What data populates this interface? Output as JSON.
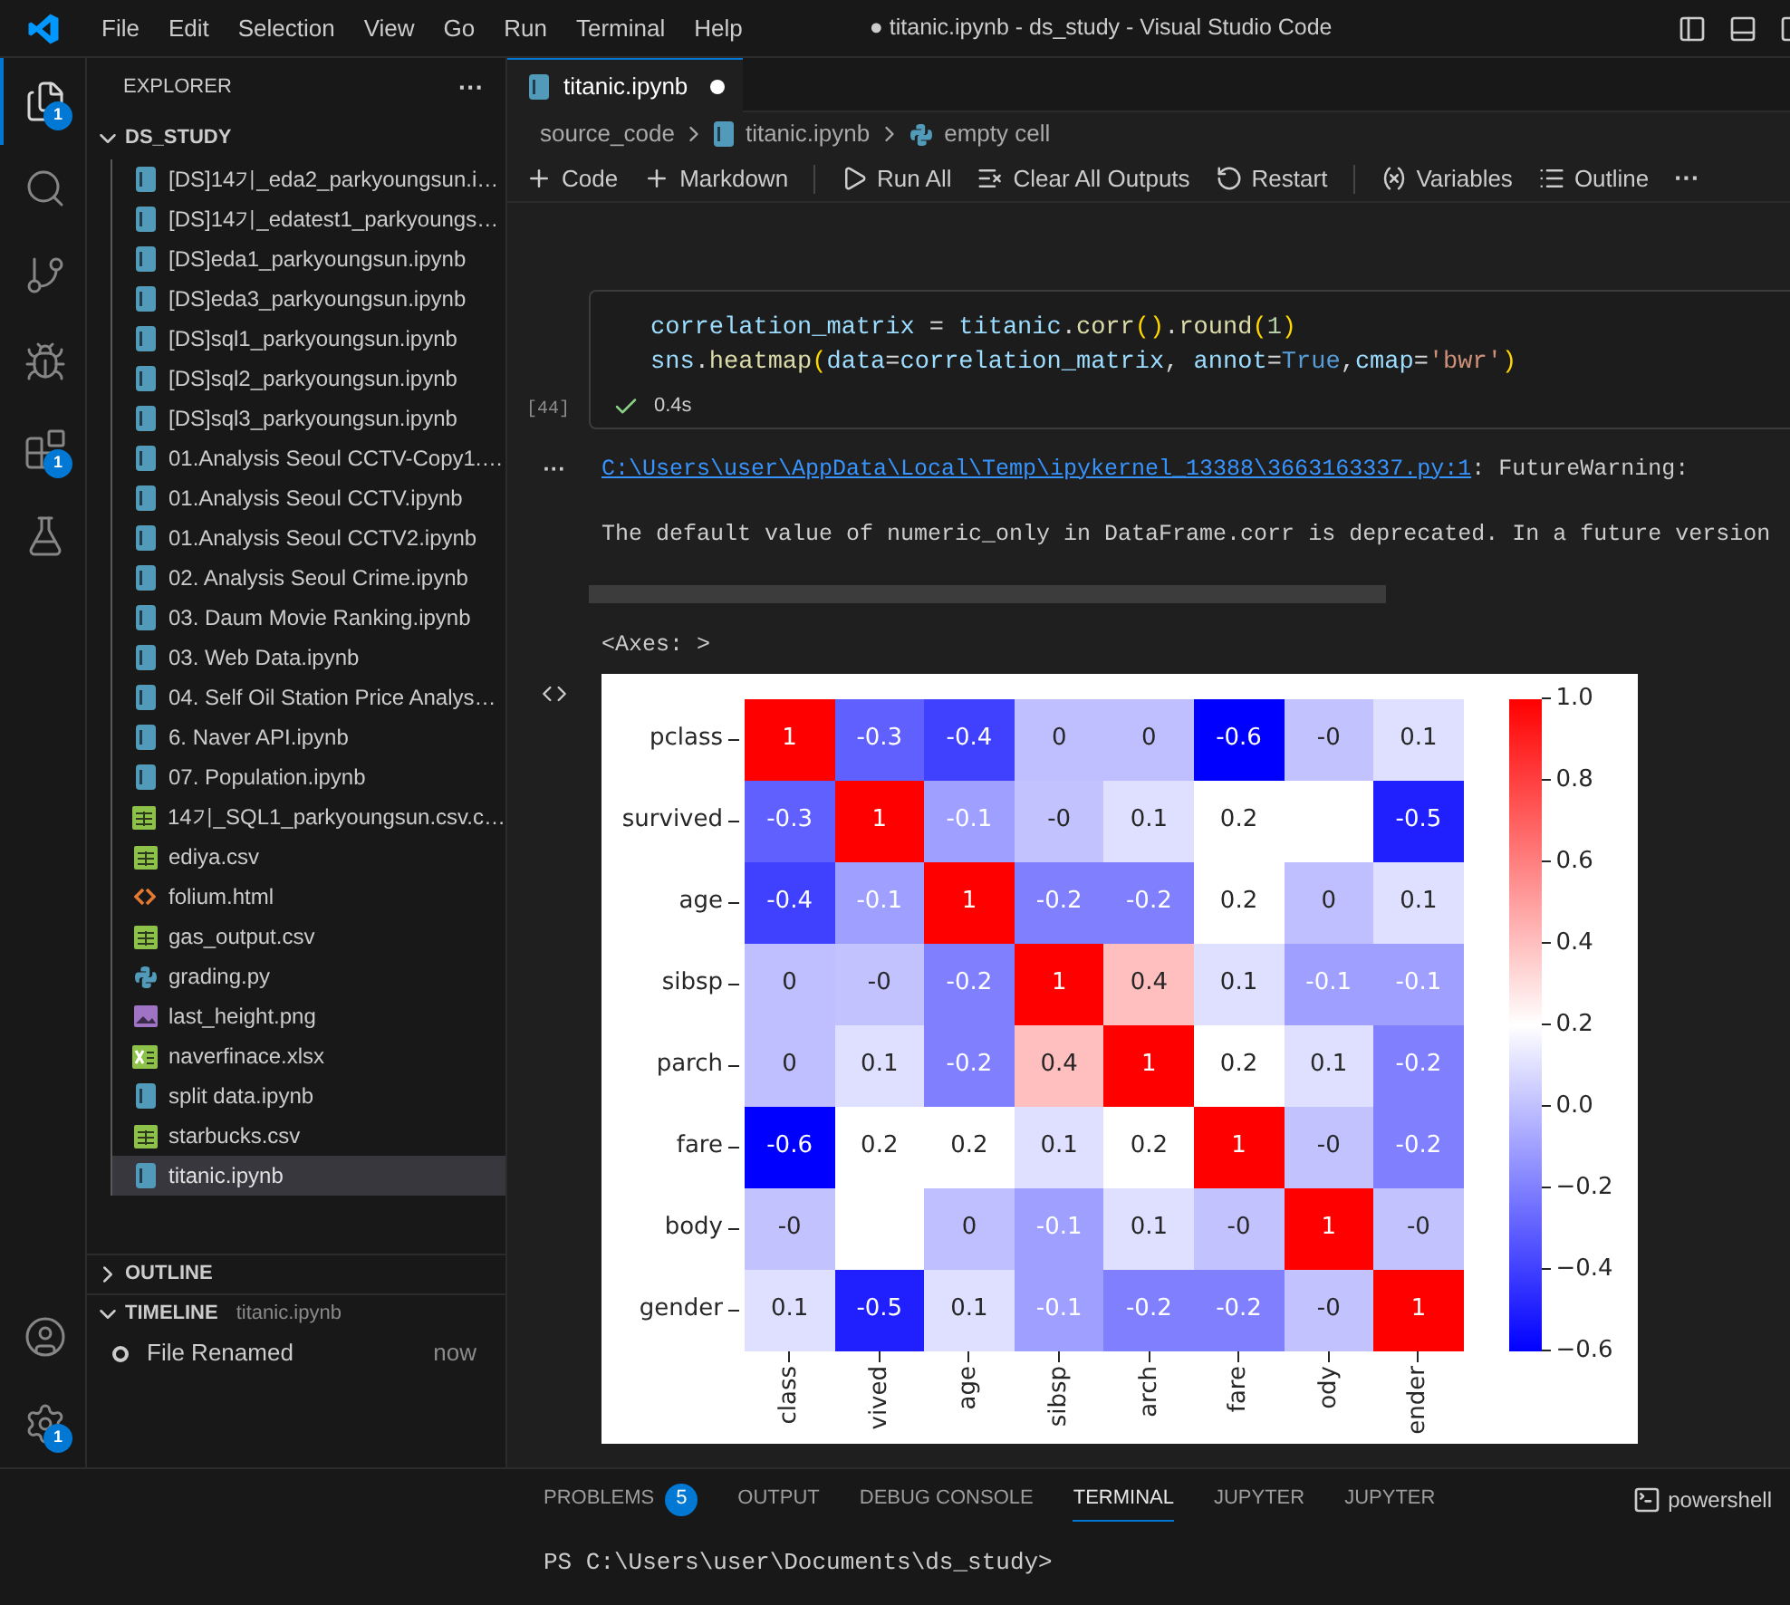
{
  "title_bar": {
    "menus": [
      "File",
      "Edit",
      "Selection",
      "View",
      "Go",
      "Run",
      "Terminal",
      "Help"
    ],
    "title": "● titanic.ipynb - ds_study - Visual Studio Code"
  },
  "activity_bar": {
    "items": [
      {
        "kind": "explorer",
        "selected": true,
        "badge": "1"
      },
      {
        "kind": "search",
        "selected": false
      },
      {
        "kind": "source_control",
        "selected": false
      },
      {
        "kind": "run_debug",
        "selected": false
      },
      {
        "kind": "extensions",
        "selected": false,
        "badge": "1"
      },
      {
        "kind": "testing",
        "selected": false
      }
    ],
    "bottom": [
      {
        "kind": "account",
        "selected": false
      },
      {
        "kind": "settings",
        "selected": false,
        "badge": "1"
      }
    ]
  },
  "sidebar": {
    "title": "EXPLORER",
    "more": "···",
    "folder": "DS_STUDY",
    "files": [
      {
        "name": "[DS]14기_eda2_parkyoungsun.i…",
        "kind": "notebook",
        "selected": false
      },
      {
        "name": "[DS]14기_edatest1_parkyoungs…",
        "kind": "notebook",
        "selected": false
      },
      {
        "name": "[DS]eda1_parkyoungsun.ipynb",
        "kind": "notebook",
        "selected": false
      },
      {
        "name": "[DS]eda3_parkyoungsun.ipynb",
        "kind": "notebook",
        "selected": false
      },
      {
        "name": "[DS]sql1_parkyoungsun.ipynb",
        "kind": "notebook",
        "selected": false
      },
      {
        "name": "[DS]sql2_parkyoungsun.ipynb",
        "kind": "notebook",
        "selected": false
      },
      {
        "name": "[DS]sql3_parkyoungsun.ipynb",
        "kind": "notebook",
        "selected": false
      },
      {
        "name": "01.Analysis Seoul CCTV-Copy1.…",
        "kind": "notebook",
        "selected": false
      },
      {
        "name": "01.Analysis Seoul CCTV.ipynb",
        "kind": "notebook",
        "selected": false
      },
      {
        "name": "01.Analysis Seoul CCTV2.ipynb",
        "kind": "notebook",
        "selected": false
      },
      {
        "name": "02. Analysis Seoul Crime.ipynb",
        "kind": "notebook",
        "selected": false
      },
      {
        "name": "03. Daum Movie Ranking.ipynb",
        "kind": "notebook",
        "selected": false
      },
      {
        "name": "03. Web Data.ipynb",
        "kind": "notebook",
        "selected": false
      },
      {
        "name": "04. Self Oil Station Price Analys…",
        "kind": "notebook",
        "selected": false
      },
      {
        "name": "6. Naver API.ipynb",
        "kind": "notebook",
        "selected": false
      },
      {
        "name": "07. Population.ipynb",
        "kind": "notebook",
        "selected": false
      },
      {
        "name": "14기_SQL1_parkyoungsun.csv.c…",
        "kind": "csv",
        "selected": false
      },
      {
        "name": "ediya.csv",
        "kind": "csv",
        "selected": false
      },
      {
        "name": "folium.html",
        "kind": "html",
        "selected": false
      },
      {
        "name": "gas_output.csv",
        "kind": "csv",
        "selected": false
      },
      {
        "name": "grading.py",
        "kind": "python",
        "selected": false
      },
      {
        "name": "last_height.png",
        "kind": "image",
        "selected": false
      },
      {
        "name": "naverfinace.xlsx",
        "kind": "excel",
        "selected": false
      },
      {
        "name": "split data.ipynb",
        "kind": "notebook",
        "selected": false
      },
      {
        "name": "starbucks.csv",
        "kind": "csv",
        "selected": false
      },
      {
        "name": "titanic.ipynb",
        "kind": "notebook",
        "selected": true
      }
    ],
    "outline": {
      "title": "OUTLINE",
      "expanded": false
    },
    "timeline": {
      "title": "TIMELINE",
      "expanded": true,
      "file": "titanic.ipynb",
      "events": [
        {
          "label": "File Renamed",
          "time": "now"
        }
      ]
    }
  },
  "editor": {
    "tabs": [
      {
        "label": "titanic.ipynb",
        "selected": true,
        "modified": true
      }
    ],
    "breadcrumbs": [
      {
        "label": "source_code",
        "kind": "folder"
      },
      {
        "label": "titanic.ipynb",
        "kind": "notebook"
      },
      {
        "label": "empty cell",
        "kind": "python"
      }
    ],
    "toolbar": [
      {
        "label": "Code",
        "kind": "add"
      },
      {
        "label": "Markdown",
        "kind": "add"
      },
      {
        "label": "Run All",
        "kind": "run"
      },
      {
        "label": "Clear All Outputs",
        "kind": "clear"
      },
      {
        "label": "Restart",
        "kind": "restart"
      },
      {
        "label": "Variables",
        "kind": "variables"
      },
      {
        "label": "Outline",
        "kind": "outline"
      }
    ],
    "toolbar_more": "···"
  },
  "cell": {
    "execution_count": "[44]",
    "success": true,
    "duration": "0.4s",
    "lines": [
      [
        {
          "text": "correlation_matrix",
          "kind": "var"
        },
        {
          "text": " = ",
          "kind": "op"
        },
        {
          "text": "titanic",
          "kind": "var"
        },
        {
          "text": ".",
          "kind": "op"
        },
        {
          "text": "corr",
          "kind": "fn"
        },
        {
          "text": "()",
          "kind": "paren"
        },
        {
          "text": ".",
          "kind": "op"
        },
        {
          "text": "round",
          "kind": "fn"
        },
        {
          "text": "(",
          "kind": "paren"
        },
        {
          "text": "1",
          "kind": "num"
        },
        {
          "text": ")",
          "kind": "paren"
        }
      ],
      [
        {
          "text": "sns",
          "kind": "var"
        },
        {
          "text": ".",
          "kind": "op"
        },
        {
          "text": "heatmap",
          "kind": "fn"
        },
        {
          "text": "(",
          "kind": "paren"
        },
        {
          "text": "data",
          "kind": "var"
        },
        {
          "text": "=",
          "kind": "op"
        },
        {
          "text": "correlation_matrix",
          "kind": "var"
        },
        {
          "text": ", ",
          "kind": "op"
        },
        {
          "text": "annot",
          "kind": "var"
        },
        {
          "text": "=",
          "kind": "op"
        },
        {
          "text": "True",
          "kind": "kw"
        },
        {
          "text": ",",
          "kind": "op"
        },
        {
          "text": "cmap",
          "kind": "var"
        },
        {
          "text": "=",
          "kind": "op"
        },
        {
          "text": "'bwr'",
          "kind": "str"
        },
        {
          "text": ")",
          "kind": "paren"
        }
      ]
    ]
  },
  "output": {
    "more": "···",
    "warning_link": "C:\\Users\\user\\AppData\\Local\\Temp\\ipykernel_13388\\3663163337.py:1",
    "warning_label": ": FutureWarning:",
    "warning_text": "The default value of numeric_only in DataFrame.corr is deprecated. In a future version",
    "result": "<Axes: >",
    "figure": {
      "row_labels": [
        "pclass",
        "survived",
        "age",
        "sibsp",
        "parch",
        "fare",
        "body",
        "gender"
      ],
      "column_labels": [
        "class",
        "vived",
        "age",
        "sibsp",
        "arch",
        "fare",
        "ody",
        "ender"
      ],
      "cells": [
        [
          {
            "text": "1",
            "color": "#ff0000"
          },
          {
            "text": "-0.3",
            "color": "#6060ff"
          },
          {
            "text": "-0.4",
            "color": "#4040ff"
          },
          {
            "text": "0",
            "color": "#bfbfff"
          },
          {
            "text": "0",
            "color": "#bfbfff"
          },
          {
            "text": "-0.6",
            "color": "#0000ff"
          },
          {
            "text": "-0",
            "color": "#c2c2ff"
          },
          {
            "text": "0.1",
            "color": "#dfdfff"
          }
        ],
        [
          {
            "text": "-0.3",
            "color": "#6060ff"
          },
          {
            "text": "1",
            "color": "#ff0000"
          },
          {
            "text": "-0.1",
            "color": "#9f9fff"
          },
          {
            "text": "-0",
            "color": "#c2c2ff"
          },
          {
            "text": "0.1",
            "color": "#dfdfff"
          },
          {
            "text": "0.2",
            "color": "#ffffff"
          },
          null,
          {
            "text": "-0.5",
            "color": "#2020ff"
          }
        ],
        [
          {
            "text": "-0.4",
            "color": "#4040ff"
          },
          {
            "text": "-0.1",
            "color": "#9f9fff"
          },
          {
            "text": "1",
            "color": "#ff0000"
          },
          {
            "text": "-0.2",
            "color": "#8080ff"
          },
          {
            "text": "-0.2",
            "color": "#8080ff"
          },
          {
            "text": "0.2",
            "color": "#ffffff"
          },
          {
            "text": "0",
            "color": "#bfbfff"
          },
          {
            "text": "0.1",
            "color": "#dfdfff"
          }
        ],
        [
          {
            "text": "0",
            "color": "#bfbfff"
          },
          {
            "text": "-0",
            "color": "#c2c2ff"
          },
          {
            "text": "-0.2",
            "color": "#8080ff"
          },
          {
            "text": "1",
            "color": "#ff0000"
          },
          {
            "text": "0.4",
            "color": "#ffbfbf"
          },
          {
            "text": "0.1",
            "color": "#dfdfff"
          },
          {
            "text": "-0.1",
            "color": "#9f9fff"
          },
          {
            "text": "-0.1",
            "color": "#9f9fff"
          }
        ],
        [
          {
            "text": "0",
            "color": "#bfbfff"
          },
          {
            "text": "0.1",
            "color": "#dfdfff"
          },
          {
            "text": "-0.2",
            "color": "#8080ff"
          },
          {
            "text": "0.4",
            "color": "#ffbfbf"
          },
          {
            "text": "1",
            "color": "#ff0000"
          },
          {
            "text": "0.2",
            "color": "#ffffff"
          },
          {
            "text": "0.1",
            "color": "#dfdfff"
          },
          {
            "text": "-0.2",
            "color": "#8080ff"
          }
        ],
        [
          {
            "text": "-0.6",
            "color": "#0000ff"
          },
          {
            "text": "0.2",
            "color": "#ffffff"
          },
          {
            "text": "0.2",
            "color": "#ffffff"
          },
          {
            "text": "0.1",
            "color": "#dfdfff"
          },
          {
            "text": "0.2",
            "color": "#ffffff"
          },
          {
            "text": "1",
            "color": "#ff0000"
          },
          {
            "text": "-0",
            "color": "#c2c2ff"
          },
          {
            "text": "-0.2",
            "color": "#8080ff"
          }
        ],
        [
          {
            "text": "-0",
            "color": "#c2c2ff"
          },
          null,
          {
            "text": "0",
            "color": "#bfbfff"
          },
          {
            "text": "-0.1",
            "color": "#9f9fff"
          },
          {
            "text": "0.1",
            "color": "#dfdfff"
          },
          {
            "text": "-0",
            "color": "#c2c2ff"
          },
          {
            "text": "1",
            "color": "#ff0000"
          },
          {
            "text": "-0",
            "color": "#c2c2ff"
          }
        ],
        [
          {
            "text": "0.1",
            "color": "#dfdfff"
          },
          {
            "text": "-0.5",
            "color": "#2020ff"
          },
          {
            "text": "0.1",
            "color": "#dfdfff"
          },
          {
            "text": "-0.1",
            "color": "#9f9fff"
          },
          {
            "text": "-0.2",
            "color": "#8080ff"
          },
          {
            "text": "-0.2",
            "color": "#8080ff"
          },
          {
            "text": "-0",
            "color": "#c2c2ff"
          },
          {
            "text": "1",
            "color": "#ff0000"
          }
        ]
      ],
      "colorbar_ticks": [
        "1.0",
        "0.8",
        "0.6",
        "0.4",
        "0.2",
        "0.0",
        "−0.2",
        "−0.4",
        "−0.6"
      ]
    }
  },
  "panel": {
    "tabs": [
      {
        "label": "PROBLEMS",
        "selected": false,
        "badge": "5"
      },
      {
        "label": "OUTPUT",
        "selected": false
      },
      {
        "label": "DEBUG CONSOLE",
        "selected": false
      },
      {
        "label": "TERMINAL",
        "selected": true
      },
      {
        "label": "JUPYTER",
        "selected": false
      },
      {
        "label": "JUPYTER",
        "selected": false
      }
    ],
    "shell": "powershell",
    "terminal_line": "PS C:\\Users\\user\\Documents\\ds_study>"
  }
}
